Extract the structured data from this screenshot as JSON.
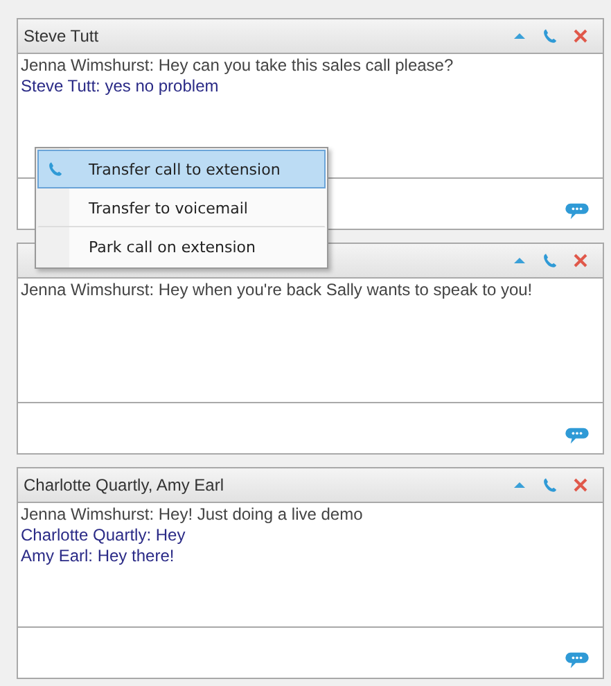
{
  "chats": [
    {
      "title": "Steve Tutt",
      "messages": [
        {
          "kind": "incoming",
          "text": "Jenna Wimshurst: Hey can you take this sales call please?"
        },
        {
          "kind": "outgoing",
          "text": "Steve Tutt: yes no problem"
        }
      ]
    },
    {
      "messages": [
        {
          "kind": "incoming",
          "text": "Jenna Wimshurst: Hey when you're back Sally wants to speak to you!"
        }
      ]
    },
    {
      "title": "Charlotte Quartly, Amy Earl",
      "messages": [
        {
          "kind": "incoming",
          "text": "Jenna Wimshurst: Hey! Just doing a live demo"
        },
        {
          "kind": "outgoing",
          "text": "Charlotte Quartly: Hey"
        },
        {
          "kind": "outgoing",
          "text": "Amy Earl: Hey there!"
        }
      ]
    }
  ],
  "context_menu": {
    "items": [
      {
        "label": "Transfer call to extension",
        "selected": true
      },
      {
        "label": "Transfer to voicemail",
        "selected": false
      },
      {
        "label": "Park call on extension",
        "selected": false
      }
    ]
  }
}
